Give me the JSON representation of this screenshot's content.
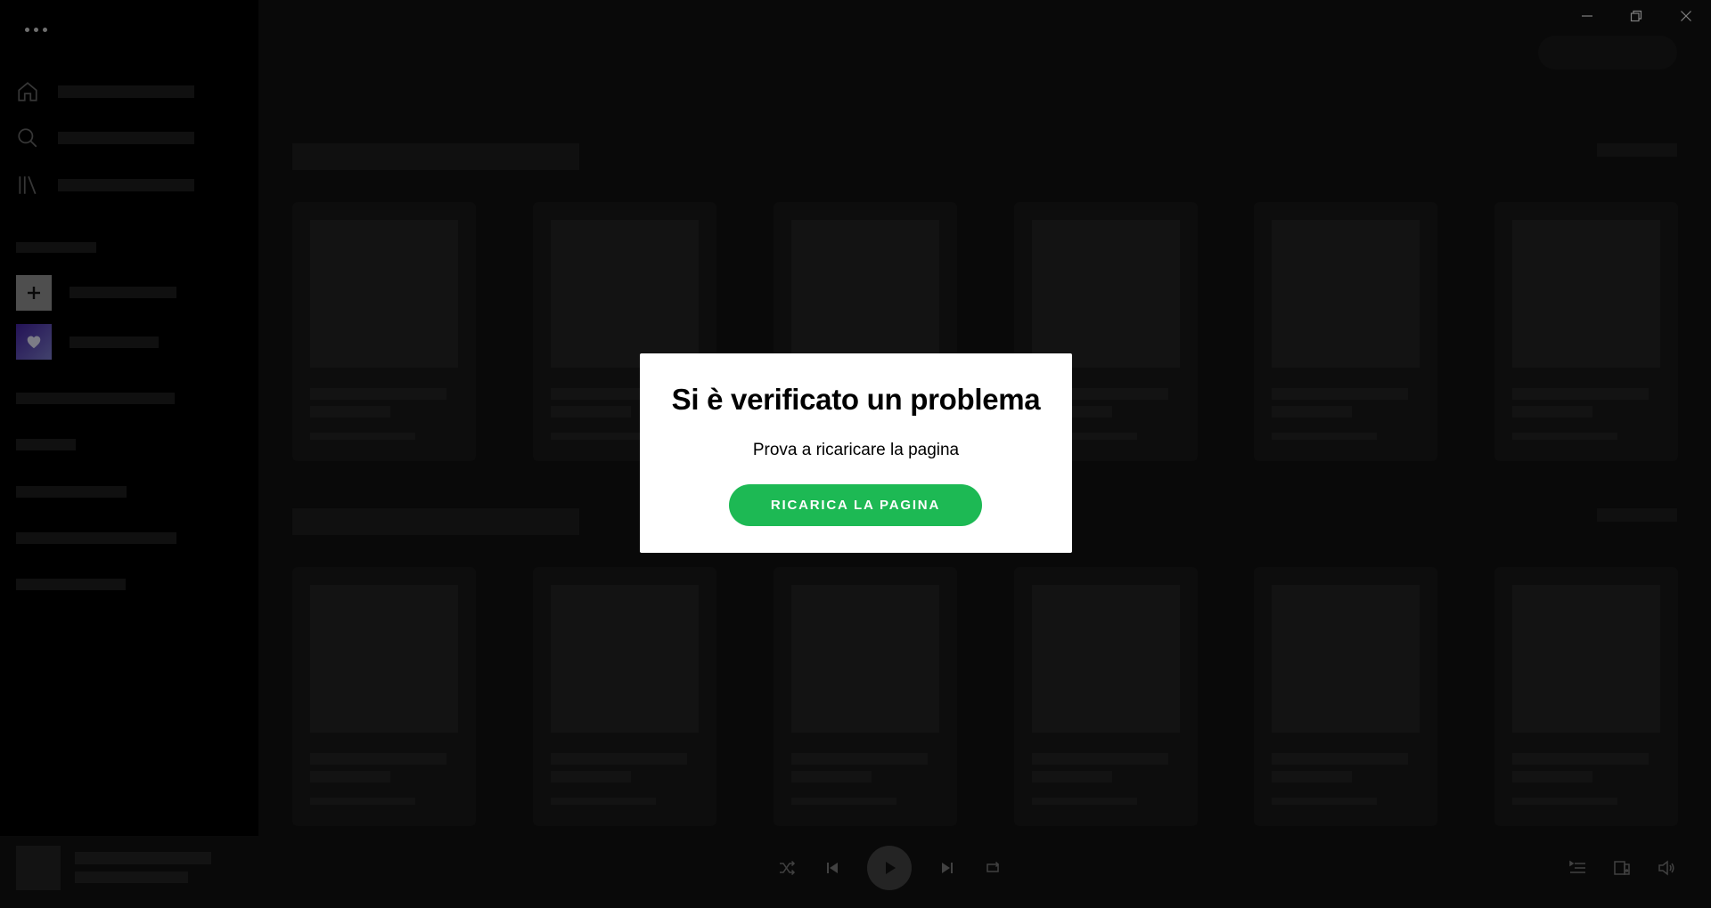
{
  "dialog": {
    "title": "Si è verificato un problema",
    "message": "Prova a ricaricare la pagina",
    "button_label": "RICARICA LA PAGINA"
  },
  "colors": {
    "accent": "#1db954",
    "background": "#000000",
    "main_background": "#0f0f0f",
    "skeleton": "#1a1a1a",
    "dialog_background": "#ffffff"
  },
  "icons": {
    "menu": "more-horizontal-icon",
    "home": "home-icon",
    "search": "search-icon",
    "library": "library-icon",
    "create_playlist": "plus-icon",
    "liked_songs": "heart-icon",
    "minimize": "minimize-icon",
    "maximize": "restore-icon",
    "close": "close-icon",
    "shuffle": "shuffle-icon",
    "previous": "skip-back-icon",
    "play": "play-icon",
    "next": "skip-forward-icon",
    "repeat": "repeat-icon",
    "queue": "queue-icon",
    "devices": "devices-icon",
    "volume": "volume-icon"
  }
}
